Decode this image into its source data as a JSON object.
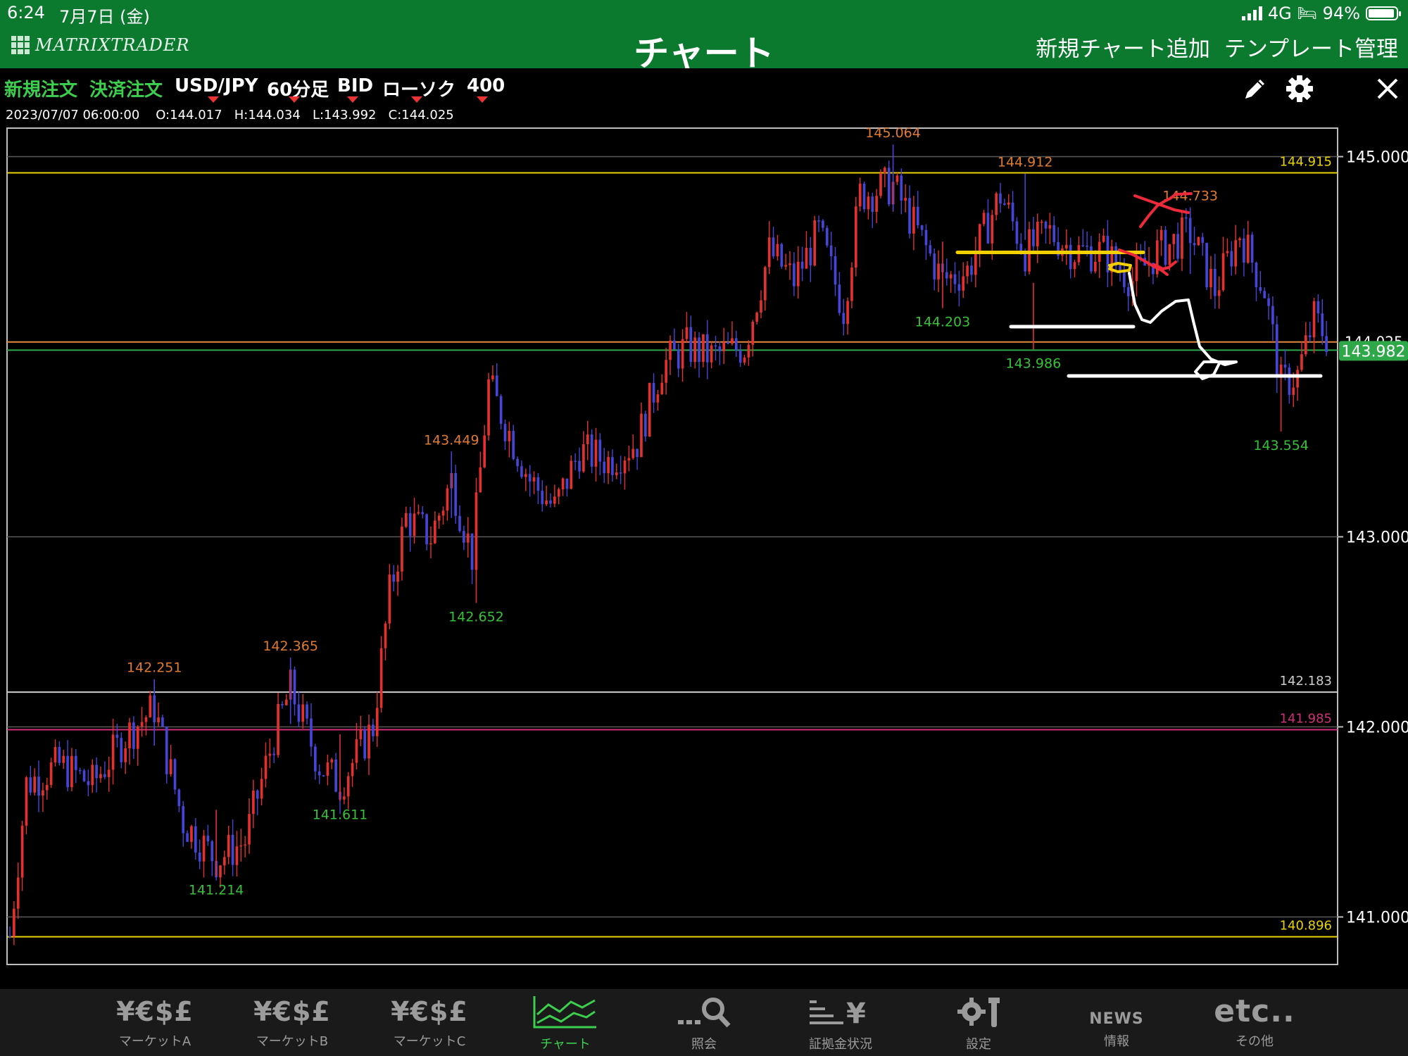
{
  "status_bar": {
    "time": "6:24",
    "date": "7月7日 (金)",
    "network": "4G",
    "battery": "94%",
    "battery_level": 0.94
  },
  "header": {
    "logo": "MATRIXTRADER",
    "title": "チャート",
    "add_chart": "新規チャート追加",
    "template_manage": "テンプレート管理"
  },
  "toolbar": {
    "new_order": "新規注文",
    "settle_order": "決済注文",
    "pair": "USD/JPY",
    "timeframe": "60分足",
    "price_type": "BID",
    "chart_style": "ローソク",
    "bars": "400"
  },
  "ohlc": {
    "datetime": "2023/07/07 06:00:00",
    "open": "O:144.017",
    "high": "H:144.034",
    "low": "L:143.992",
    "close": "C:144.025"
  },
  "tabs": [
    {
      "icon": "¥€$£",
      "label": "マーケットA",
      "active": false
    },
    {
      "icon": "¥€$£",
      "label": "マーケットB",
      "active": false
    },
    {
      "icon": "¥€$£",
      "label": "マーケットC",
      "active": false
    },
    {
      "icon": "chart",
      "label": "チャート",
      "active": true
    },
    {
      "icon": "search",
      "label": "照会",
      "active": false
    },
    {
      "icon": "margin",
      "label": "証拠金状況",
      "active": false
    },
    {
      "icon": "settings",
      "label": "設定",
      "active": false
    },
    {
      "icon": "NEWS",
      "label": "情報",
      "active": false
    },
    {
      "icon": "etc..",
      "label": "その他",
      "active": false
    }
  ],
  "colors": {
    "header_bg": "#0b7a2e",
    "bull": "#e53030",
    "bear": "#4545d8",
    "high_label": "#e07a30",
    "low_label": "#36c236",
    "yellow_line": "#e8d200",
    "current_price_bg": "#2fa84a"
  },
  "chart_data": {
    "type": "candlestick",
    "ylim": [
      140.75,
      145.15
    ],
    "y_ticks": [
      "145.000",
      "143.000",
      "142.000",
      "141.000"
    ],
    "y_tick_values": [
      145.0,
      143.0,
      142.0,
      141.0
    ],
    "current_price": "143.982",
    "current_price_value": 143.982,
    "current_price_hidden": "144.025",
    "horizontal_lines": [
      {
        "price": 144.915,
        "label": "144.915",
        "color": "#e8d200"
      },
      {
        "price": 142.183,
        "label": "142.183",
        "color": "#cccccc"
      },
      {
        "price": 141.985,
        "label": "141.985",
        "color": "#d0307a"
      },
      {
        "price": 140.896,
        "label": "140.896",
        "color": "#e8d200"
      },
      {
        "price": 144.025,
        "label": "",
        "color": "#e08a40"
      },
      {
        "price": 143.982,
        "label": "",
        "color": "#2fa84a"
      }
    ],
    "high_labels": [
      {
        "bar": 35,
        "price": 142.251,
        "label": "142.251"
      },
      {
        "bar": 68,
        "price": 142.365,
        "label": "142.365"
      },
      {
        "bar": 107,
        "price": 143.449,
        "label": "143.449"
      },
      {
        "bar": 214,
        "price": 145.064,
        "label": "145.064"
      },
      {
        "bar": 246,
        "price": 144.912,
        "label": "144.912"
      },
      {
        "bar": 286,
        "price": 144.733,
        "label": "144.733"
      }
    ],
    "low_labels": [
      {
        "bar": 50,
        "price": 141.214,
        "label": "141.214"
      },
      {
        "bar": 80,
        "price": 141.611,
        "label": "141.611"
      },
      {
        "bar": 113,
        "price": 142.652,
        "label": "142.652"
      },
      {
        "bar": 226,
        "price": 144.203,
        "label": "144.203"
      },
      {
        "bar": 248,
        "price": 143.986,
        "label": "143.986"
      },
      {
        "bar": 308,
        "price": 143.554,
        "label": "143.554"
      }
    ],
    "bar_count": 320,
    "path_anchors": [
      [
        0,
        140.9
      ],
      [
        4,
        141.7
      ],
      [
        12,
        141.8
      ],
      [
        20,
        141.7
      ],
      [
        28,
        141.95
      ],
      [
        35,
        142.1
      ],
      [
        42,
        141.5
      ],
      [
        50,
        141.3
      ],
      [
        57,
        141.4
      ],
      [
        64,
        141.95
      ],
      [
        68,
        142.2
      ],
      [
        75,
        141.8
      ],
      [
        80,
        141.7
      ],
      [
        88,
        142.0
      ],
      [
        92,
        142.7
      ],
      [
        96,
        143.1
      ],
      [
        102,
        143.0
      ],
      [
        107,
        143.3
      ],
      [
        112,
        142.9
      ],
      [
        116,
        143.8
      ],
      [
        120,
        143.6
      ],
      [
        126,
        143.3
      ],
      [
        132,
        143.15
      ],
      [
        138,
        143.45
      ],
      [
        145,
        143.4
      ],
      [
        152,
        143.5
      ],
      [
        158,
        143.9
      ],
      [
        164,
        144.0
      ],
      [
        170,
        143.95
      ],
      [
        178,
        144.0
      ],
      [
        184,
        144.5
      ],
      [
        190,
        144.35
      ],
      [
        196,
        144.6
      ],
      [
        202,
        144.2
      ],
      [
        206,
        144.8
      ],
      [
        214,
        144.85
      ],
      [
        220,
        144.6
      ],
      [
        226,
        144.35
      ],
      [
        232,
        144.4
      ],
      [
        240,
        144.8
      ],
      [
        246,
        144.5
      ],
      [
        252,
        144.6
      ],
      [
        258,
        144.5
      ],
      [
        265,
        144.5
      ],
      [
        272,
        144.35
      ],
      [
        278,
        144.5
      ],
      [
        286,
        144.6
      ],
      [
        292,
        144.3
      ],
      [
        298,
        144.6
      ],
      [
        304,
        144.3
      ],
      [
        308,
        143.8
      ],
      [
        312,
        143.85
      ],
      [
        316,
        144.15
      ],
      [
        320,
        144.02
      ]
    ],
    "annotations": [
      {
        "kind": "line",
        "color": "#f2d000",
        "points": [
          [
            1360,
            188.5
          ],
          [
            1624,
            188.5
          ]
        ]
      },
      {
        "kind": "line",
        "color": "#ffffff",
        "points": [
          [
            1436,
            294
          ],
          [
            1610,
            294
          ]
        ]
      },
      {
        "kind": "line",
        "color": "#ffffff",
        "points": [
          [
            1518,
            364
          ],
          [
            1876,
            364
          ]
        ]
      },
      {
        "kind": "path",
        "color": "#f2d000",
        "points": [
          [
            1576,
            207
          ],
          [
            1588,
            204
          ],
          [
            1606,
            207
          ],
          [
            1604,
            214
          ],
          [
            1588,
            216
          ],
          [
            1576,
            212
          ],
          [
            1580,
            206
          ]
        ]
      },
      {
        "kind": "path",
        "color": "#ffffff",
        "points": [
          [
            1604,
            218
          ],
          [
            1612,
            262
          ],
          [
            1622,
            284
          ],
          [
            1634,
            288
          ],
          [
            1650,
            272
          ],
          [
            1670,
            258
          ],
          [
            1688,
            256
          ],
          [
            1696,
            290
          ],
          [
            1704,
            322
          ],
          [
            1720,
            340
          ],
          [
            1740,
            348
          ],
          [
            1756,
            344
          ],
          [
            1710,
            344
          ],
          [
            1698,
            358
          ],
          [
            1708,
            368
          ],
          [
            1724,
            362
          ],
          [
            1732,
            346
          ]
        ]
      },
      {
        "kind": "path",
        "color": "#ee2a3a",
        "points": [
          [
            1590,
            185
          ],
          [
            1610,
            192
          ],
          [
            1628,
            202
          ],
          [
            1638,
            208
          ],
          [
            1650,
            214
          ],
          [
            1658,
            220
          ]
        ]
      },
      {
        "kind": "path",
        "color": "#ee2a3a",
        "points": [
          [
            1612,
            108
          ],
          [
            1640,
            118
          ],
          [
            1668,
            128
          ],
          [
            1688,
            132
          ]
        ]
      },
      {
        "kind": "path",
        "color": "#ee2a3a",
        "points": [
          [
            1620,
            152
          ],
          [
            1632,
            136
          ],
          [
            1644,
            122
          ],
          [
            1654,
            116
          ],
          [
            1662,
            112
          ],
          [
            1670,
            106
          ],
          [
            1692,
            105
          ]
        ]
      },
      {
        "kind": "path",
        "color": "#ee2a3a",
        "points": [
          [
            1640,
            206
          ],
          [
            1652,
            212
          ],
          [
            1660,
            210
          ],
          [
            1670,
            202
          ]
        ]
      }
    ]
  }
}
